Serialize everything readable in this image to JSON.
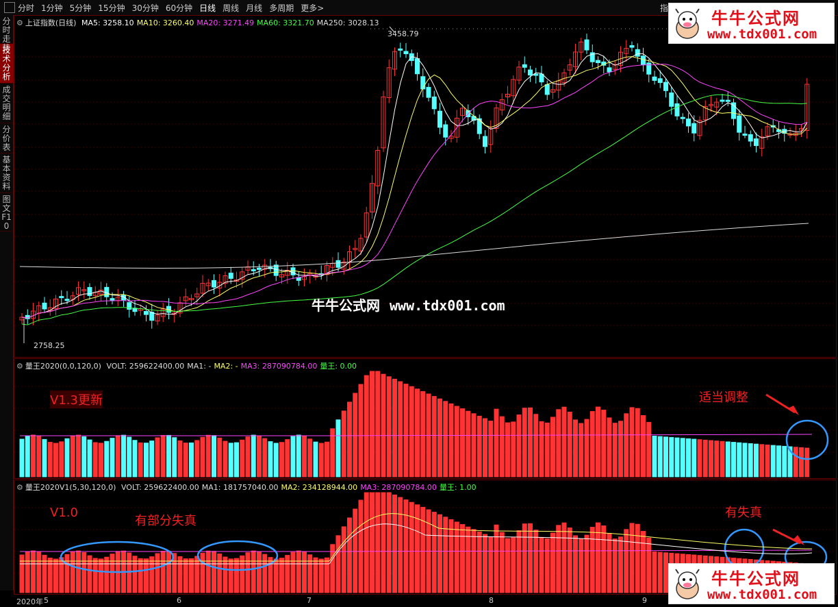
{
  "toolbar": {
    "periods": [
      "分时",
      "1分钟",
      "5分钟",
      "15分钟",
      "30分钟",
      "60分钟",
      "日线",
      "周线",
      "月线",
      "多周期",
      "更多>"
    ],
    "active_period": "日线",
    "right_label": "指"
  },
  "sidebar": {
    "tabs": [
      "分时走势",
      "技术分析",
      "成交明细",
      "分价表",
      "基本资料",
      "图文F10"
    ],
    "active_tab": "技术分析"
  },
  "main_chart": {
    "title": "上证指数(日线)",
    "ma_labels": [
      {
        "text": "MA5: 3258.10",
        "color": "#ffffff"
      },
      {
        "text": "MA10: 3260.40",
        "color": "#ffff66"
      },
      {
        "text": "MA20: 3271.49",
        "color": "#ff44ff"
      },
      {
        "text": "MA60: 3321.70",
        "color": "#44ff44"
      },
      {
        "text": "MA250: 3028.13",
        "color": "#dddddd"
      }
    ],
    "high_label": "3458.79",
    "low_label": "2758.25"
  },
  "vol1_chart": {
    "title": "量王2020(0,0,120,0)",
    "legend": [
      {
        "text": "VOLT: 259622400.00",
        "color": "#dddddd"
      },
      {
        "text": "MA1: -",
        "color": "#dddddd"
      },
      {
        "text": "MA2: -",
        "color": "#ffff66"
      },
      {
        "text": "MA3: 287090784.00",
        "color": "#ff44ff"
      },
      {
        "text": "量王: 0.00",
        "color": "#44ff44"
      }
    ],
    "annotation_left": "V1.3更新",
    "annotation_right": "适当调整"
  },
  "vol2_chart": {
    "title": "量王2020V1(5,30,120,0)",
    "legend": [
      {
        "text": "VOLT: 259622400.00",
        "color": "#dddddd"
      },
      {
        "text": "MA1: 181757040.00",
        "color": "#dddddd"
      },
      {
        "text": "MA2: 234128944.00",
        "color": "#ffff66"
      },
      {
        "text": "MA3: 287090784.00",
        "color": "#ff44ff"
      },
      {
        "text": "量王: 1.00",
        "color": "#44ff44"
      }
    ],
    "annotation_left": "V1.0",
    "annotation_mid": "有部分失真",
    "annotation_right": "有失真"
  },
  "x_axis": {
    "labels": [
      "2020年",
      "5",
      "6",
      "7",
      "8",
      "9"
    ]
  },
  "watermark": {
    "name": "牛牛公式网",
    "url": "www.tdx001.com"
  },
  "colors": {
    "up": "#ff3333",
    "down": "#55ffff",
    "accent": "#ee2222",
    "circle": "#3399ff"
  },
  "chart_data": {
    "type": "candlestick",
    "ylim": [
      2758.25,
      3458.79
    ]
  }
}
